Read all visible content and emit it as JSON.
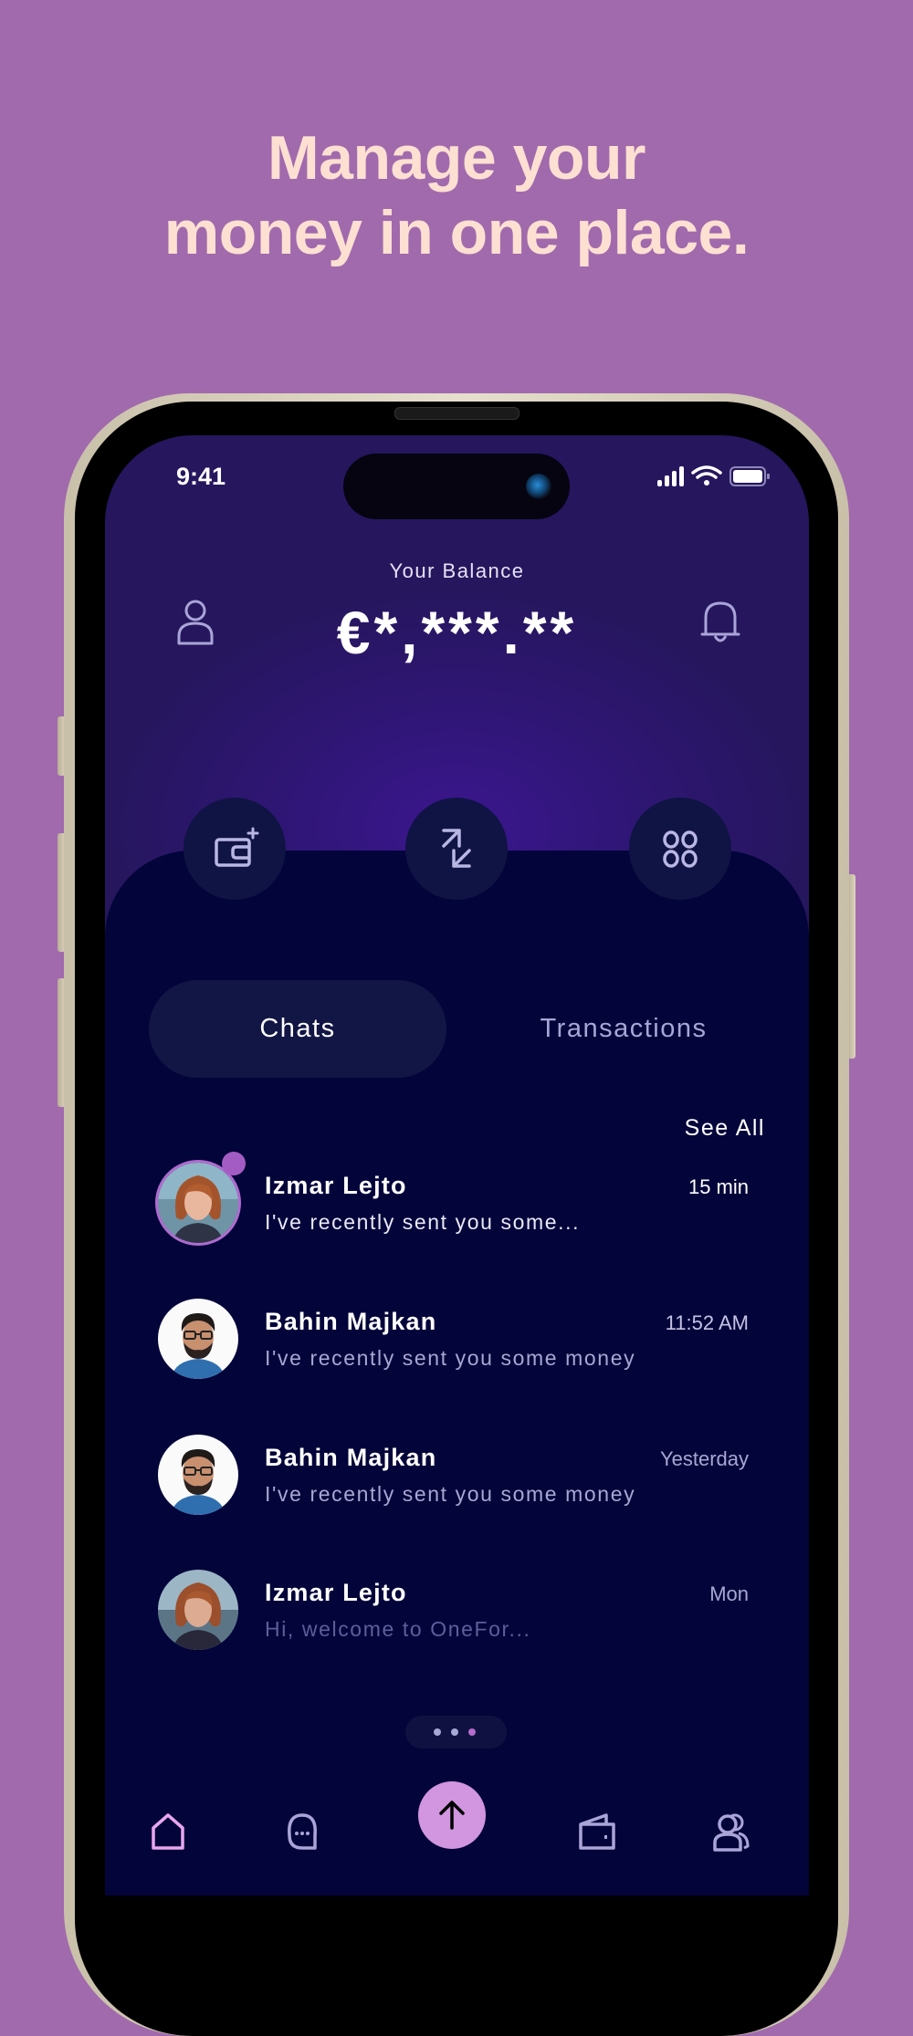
{
  "headline": {
    "line1": "Manage your",
    "line2": "money in one place."
  },
  "status_bar": {
    "time": "9:41",
    "icons": [
      "signal-icon",
      "wifi-icon",
      "battery-icon"
    ]
  },
  "header": {
    "balance_label": "Your Balance",
    "balance_value": "€*,***.**",
    "left_icon": "profile-icon",
    "right_icon": "bell-icon"
  },
  "actions": [
    {
      "name": "add-wallet",
      "icon": "wallet-add-icon"
    },
    {
      "name": "transfer",
      "icon": "transfer-arrows-icon"
    },
    {
      "name": "more-apps",
      "icon": "grid-icon"
    }
  ],
  "tabs": [
    {
      "label": "Chats",
      "active": true
    },
    {
      "label": "Transactions",
      "active": false
    }
  ],
  "see_all": "See All",
  "chats": [
    {
      "name": "Izmar Lejto",
      "message": "I've recently sent you some...",
      "time": "15 min",
      "unread": true,
      "avatar": "woman"
    },
    {
      "name": "Bahin Majkan",
      "message": "I've recently sent you some money",
      "time": "11:52 AM",
      "unread": false,
      "avatar": "man"
    },
    {
      "name": "Bahin Majkan",
      "message": "I've recently sent you some money",
      "time": "Yesterday",
      "unread": false,
      "avatar": "man"
    },
    {
      "name": "Izmar Lejto",
      "message": "Hi, welcome to OneFor...",
      "time": "Mon",
      "unread": false,
      "avatar": "woman"
    }
  ],
  "pager": {
    "count": 3,
    "active_index": 2
  },
  "bottom_nav": [
    {
      "name": "home",
      "icon": "home-icon",
      "active": true
    },
    {
      "name": "chats",
      "icon": "chat-bubble-icon",
      "active": false
    },
    {
      "name": "send",
      "icon": "arrow-up-icon",
      "active": false
    },
    {
      "name": "wallet",
      "icon": "wallet-icon",
      "active": false
    },
    {
      "name": "contacts",
      "icon": "users-icon",
      "active": false
    }
  ],
  "colors": {
    "background": "#a16aad",
    "headline": "#fde0d2",
    "accent": "#d295df",
    "panel": "#03043a",
    "badge": "#a35cc4",
    "muted_text": "#a6a7d4"
  }
}
